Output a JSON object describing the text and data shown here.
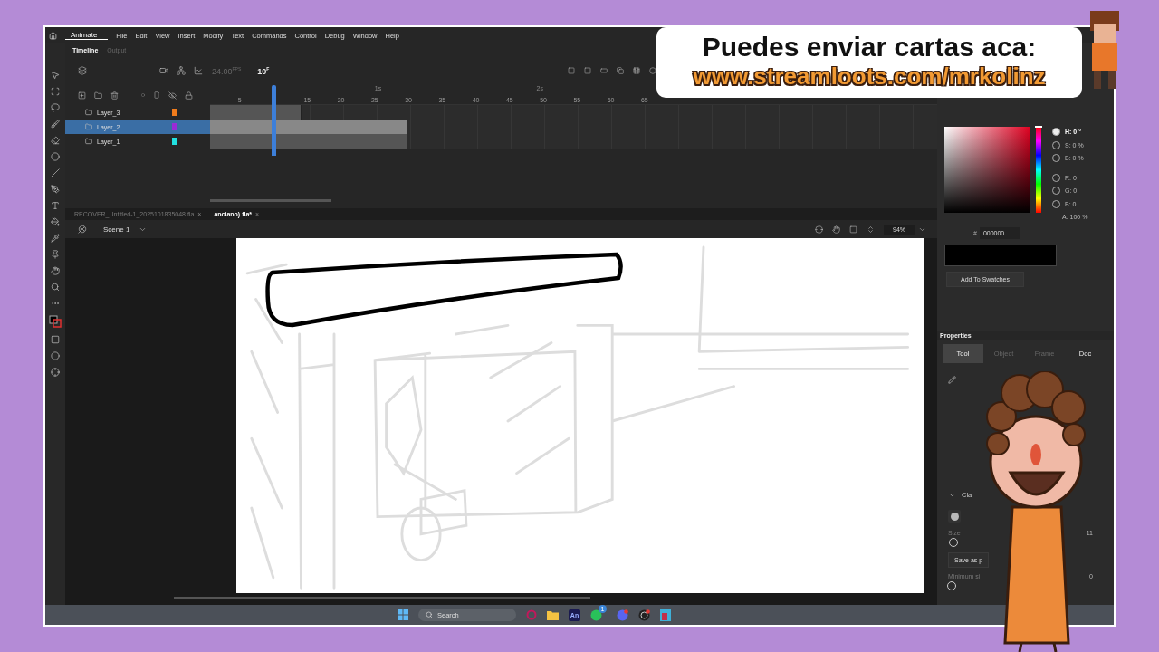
{
  "overlay": {
    "headline": "Puedes enviar cartas aca:",
    "url": "www.streamloots.com/mrkolinz"
  },
  "app": {
    "name": "Animate",
    "menu": [
      "File",
      "Edit",
      "View",
      "Insert",
      "Modify",
      "Text",
      "Commands",
      "Control",
      "Debug",
      "Window",
      "Help"
    ]
  },
  "timeline": {
    "tabs": [
      {
        "label": "Timeline",
        "selected": true
      },
      {
        "label": "Output",
        "selected": false
      }
    ],
    "fps": "24.00",
    "fps_unit": "FPS",
    "frame": "10",
    "frame_unit": "F",
    "seconds": [
      "1s",
      "2s"
    ],
    "ruler": [
      "5",
      "15",
      "20",
      "25",
      "30",
      "35",
      "40",
      "45",
      "50",
      "55",
      "60",
      "65"
    ],
    "layers": [
      {
        "name": "Layer_3",
        "color": "#f07c1c",
        "selected": false,
        "level": 0.125
      },
      {
        "name": "Layer_2",
        "color": "#9b2bd6",
        "selected": true,
        "level": 0.27
      },
      {
        "name": "Layer_1",
        "color": "#22e0e0",
        "selected": false,
        "level": 0.27
      }
    ]
  },
  "documents": [
    {
      "label": "RECOVER_Untitled-1_2025101835048.fla",
      "selected": false,
      "close": "×"
    },
    {
      "label": "anciano).fla*",
      "selected": true,
      "close": "×"
    }
  ],
  "scene": {
    "label": "Scene 1",
    "zoom": "94%"
  },
  "color": {
    "channels": [
      {
        "label": "H: 0 °",
        "selected": true,
        "kind": "radio"
      },
      {
        "label": "S: 0 %",
        "selected": false,
        "kind": "radio"
      },
      {
        "label": "B: 0 %",
        "selected": false,
        "kind": "radio"
      },
      {
        "label": "R: 0",
        "selected": false,
        "kind": "radio"
      },
      {
        "label": "G: 0",
        "selected": false,
        "kind": "radio"
      },
      {
        "label": "B: 0",
        "selected": false,
        "kind": "radio"
      },
      {
        "label": "A: 100 %",
        "kind": "plain"
      }
    ],
    "hue_slider": {
      "level": 0
    },
    "hash": "#",
    "hex": "000000",
    "button": "Add To Swatches"
  },
  "properties": {
    "title": "Properties",
    "tabs": [
      {
        "label": "Tool",
        "selected": true,
        "disabled": false
      },
      {
        "label": "Object",
        "selected": false,
        "disabled": true
      },
      {
        "label": "Frame",
        "selected": false,
        "disabled": true
      },
      {
        "label": "Doc",
        "selected": false,
        "disabled": false
      }
    ],
    "section": "Cla",
    "size_label": "Size",
    "size_value": "11",
    "size_slider": {
      "level": 0.04
    },
    "save_button": "Save as p",
    "min_label": "Minimum si",
    "min_value": "0",
    "min_slider": {
      "level": 0
    }
  },
  "taskbar": {
    "search": "Search",
    "animate_label": "An",
    "chat_badge": "1"
  }
}
